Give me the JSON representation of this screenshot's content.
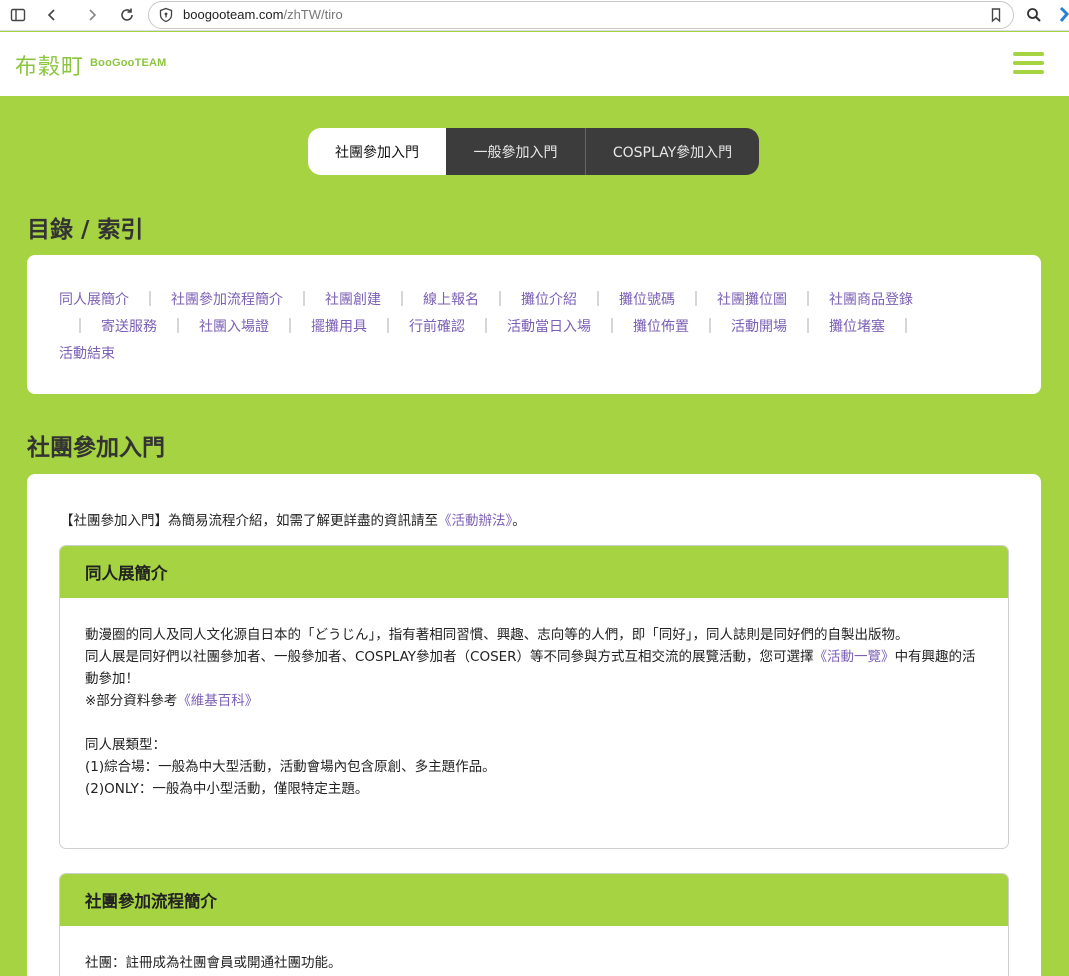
{
  "browser": {
    "url_host": "boogooteam.com",
    "url_path": "/zhTW/tiro"
  },
  "header": {
    "logo_cn": "布穀町",
    "logo_en": "BooGooTEAM"
  },
  "tabs": [
    {
      "label": "社團參加入門"
    },
    {
      "label": "一般參加入門"
    },
    {
      "label": "COSPLAY參加入門"
    }
  ],
  "index": {
    "title": "目錄 / 索引",
    "links": [
      "同人展簡介",
      "社團參加流程簡介",
      "社團創建",
      "線上報名",
      "攤位介紹",
      "攤位號碼",
      "社團攤位圖",
      "社團商品登錄",
      "寄送服務",
      "社團入場證",
      "擺攤用具",
      "行前確認",
      "活動當日入場",
      "攤位佈置",
      "活動開場",
      "攤位堵塞",
      "活動結束"
    ]
  },
  "main": {
    "title": "社團參加入門",
    "intro_prefix": "【社團參加入門】為簡易流程介紹，如需了解更詳盡的資訊請至",
    "intro_link": "《活動辦法》",
    "intro_suffix": "。",
    "panel1": {
      "title": "同人展簡介",
      "p1": "動漫圈的同人及同人文化源自日本的「どうじん」，指有著相同習慣、興趣、志向等的人們，即「同好」，同人誌則是同好們的自製出版物。",
      "p2_prefix": "同人展是同好們以社團參加者、一般參加者、COSPLAY參加者（COSER）等不同參與方式互相交流的展覽活動，您可選擇",
      "p2_link": "《活動一覽》",
      "p2_suffix": "中有興趣的活動參加！",
      "p3_prefix": "※部分資料參考",
      "p3_link": "《維基百科》",
      "types_title": "同人展類型：",
      "type1": "(1)綜合場：一般為中大型活動，活動會場內包含原創、多主題作品。",
      "type2": "(2)ONLY：一般為中小型活動，僅限特定主題。"
    },
    "panel2": {
      "title": "社團參加流程簡介",
      "p1": "社團：註冊成為社團會員或開通社團功能。"
    }
  }
}
